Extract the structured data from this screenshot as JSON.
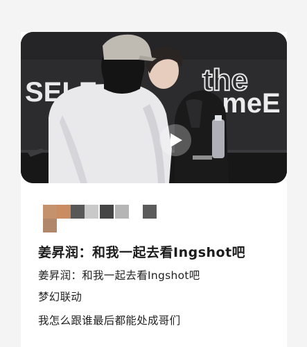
{
  "video": {
    "backdrop_text_left": "SELE",
    "backdrop_text_right_top": "the",
    "backdrop_text_right_bottom": "ameE",
    "play_icon": "play-icon",
    "accent_dark": "#2b2b2d"
  },
  "post": {
    "avatar_mosaic_colors": [
      "#c4936e",
      "#c98c63",
      "#585858",
      "#c9c9c9",
      "#454545",
      "#b5b5b5",
      "#5b5b5b",
      "#b0876a"
    ],
    "title": "姜昇润：和我一起去看Ingshot吧",
    "lines": [
      "姜昇润：和我一起去看Ingshot吧",
      "梦幻联动",
      "我怎么跟谁最后都能处成哥们"
    ]
  }
}
